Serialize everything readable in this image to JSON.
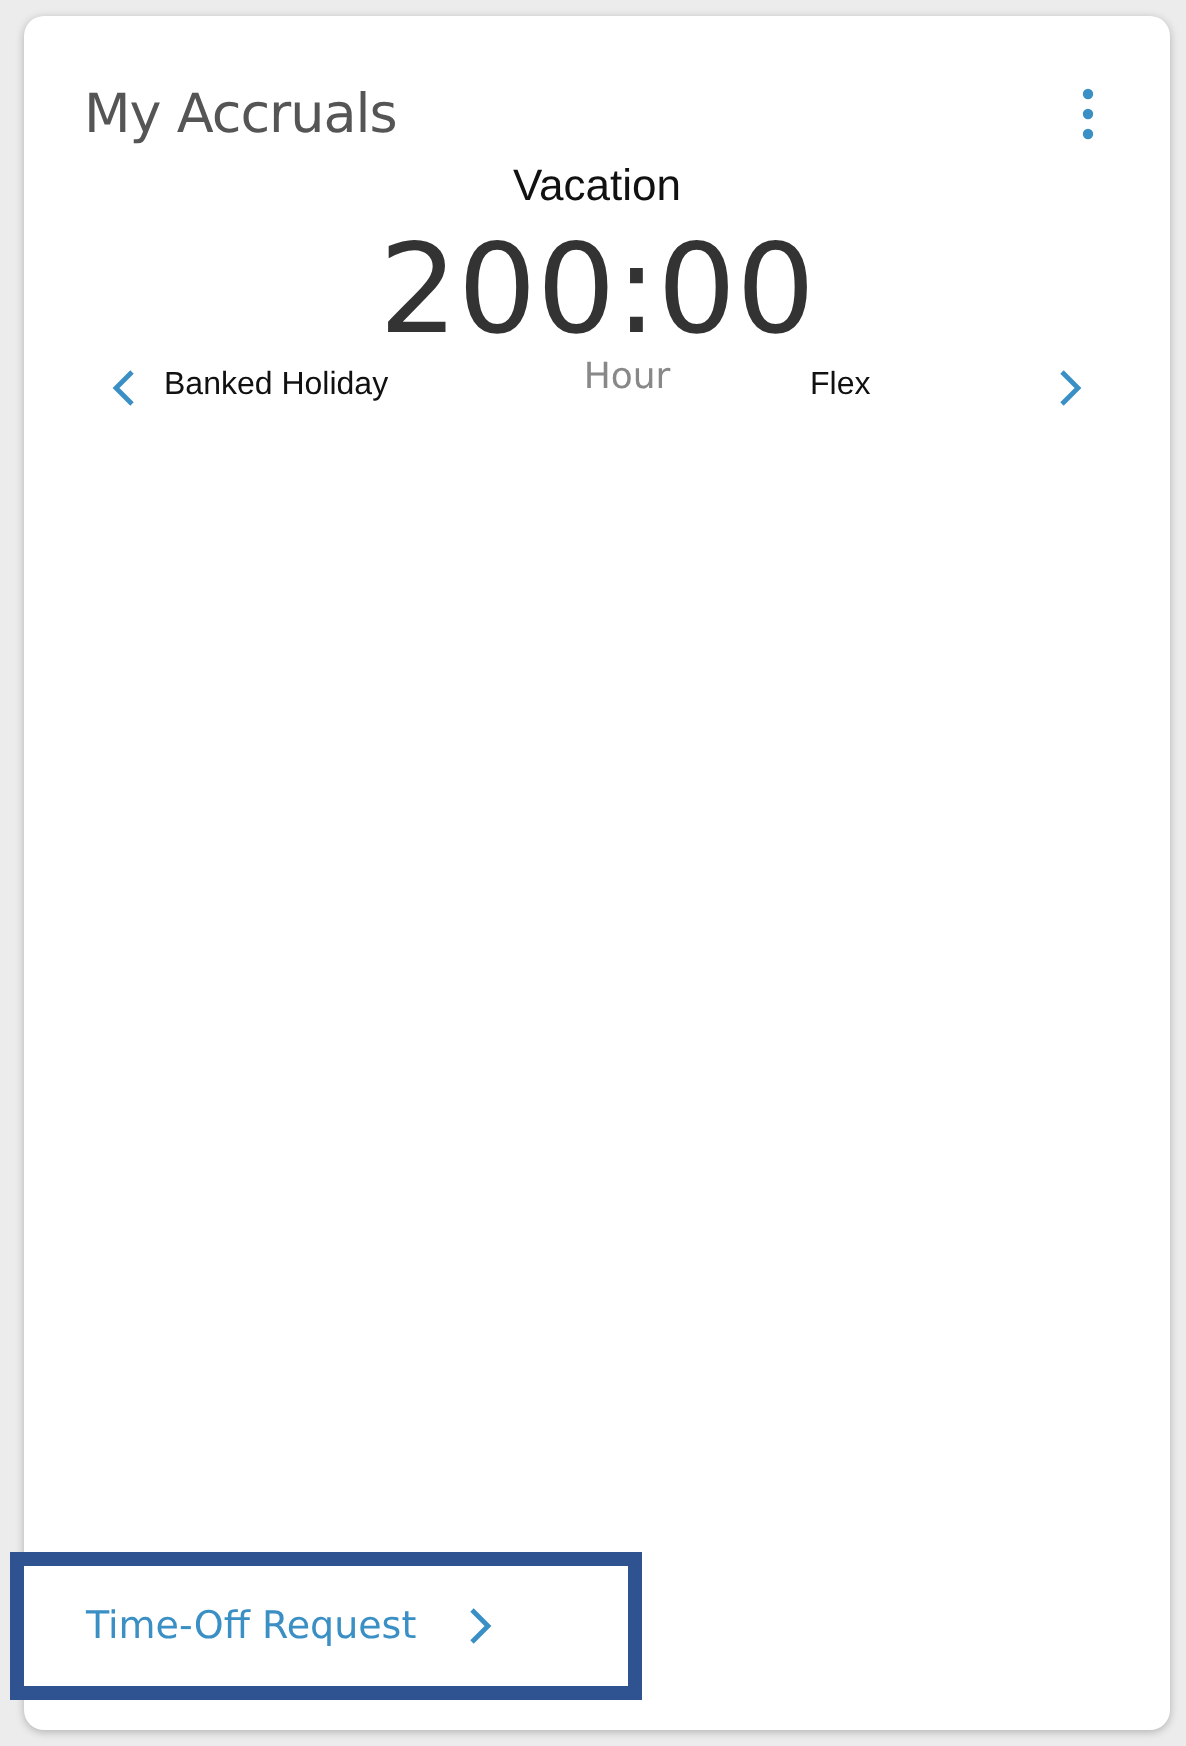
{
  "card": {
    "title": "My Accruals",
    "accrual": {
      "name": "Vacation",
      "amount": "200:00",
      "unit": "Hour",
      "previous": "Banked Holiday",
      "next": "Flex"
    },
    "footer_link": "Time-Off Request"
  }
}
